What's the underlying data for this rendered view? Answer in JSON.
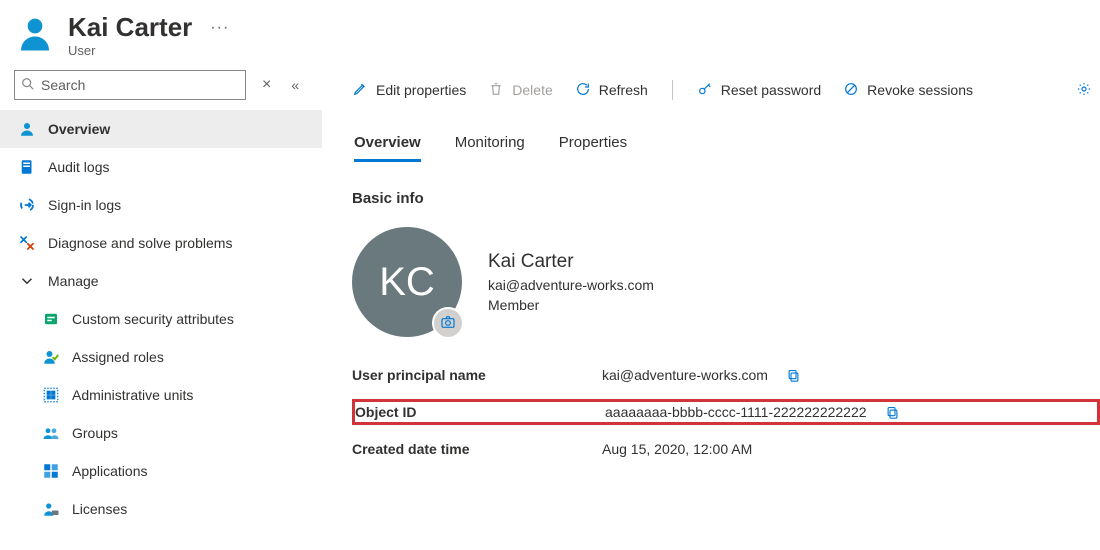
{
  "header": {
    "title": "Kai Carter",
    "subtitle": "User"
  },
  "search": {
    "placeholder": "Search"
  },
  "nav": {
    "overview": "Overview",
    "audit_logs": "Audit logs",
    "signin_logs": "Sign-in logs",
    "diagnose": "Diagnose and solve problems",
    "manage": "Manage",
    "manage_items": {
      "csa": "Custom security attributes",
      "assigned_roles": "Assigned roles",
      "admin_units": "Administrative units",
      "groups": "Groups",
      "applications": "Applications",
      "licenses": "Licenses"
    }
  },
  "toolbar": {
    "edit_properties": "Edit properties",
    "delete": "Delete",
    "refresh": "Refresh",
    "reset_password": "Reset password",
    "revoke_sessions": "Revoke sessions"
  },
  "tabs": {
    "overview": "Overview",
    "monitoring": "Monitoring",
    "properties": "Properties"
  },
  "section": {
    "basic_info_title": "Basic info"
  },
  "basic": {
    "initials": "KC",
    "name": "Kai Carter",
    "email": "kai@adventure-works.com",
    "member": "Member"
  },
  "props": {
    "upn_label": "User principal name",
    "upn_value": "kai@adventure-works.com",
    "object_id_label": "Object ID",
    "object_id_value": "aaaaaaaa-bbbb-cccc-1111-222222222222",
    "created_label": "Created date time",
    "created_value": "Aug 15, 2020, 12:00 AM"
  }
}
